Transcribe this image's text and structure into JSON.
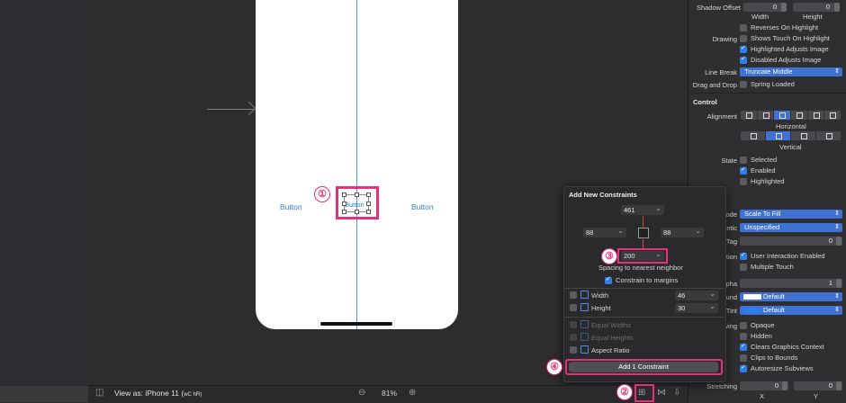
{
  "canvas": {
    "buttons": [
      "Button",
      "Button",
      "Button"
    ],
    "zoom": "81%",
    "view_as": "View as: iPhone 11 (",
    "view_as_trait": "wC hR)"
  },
  "badges": [
    "①",
    "②",
    "③",
    "④"
  ],
  "popover": {
    "title": "Add New Constraints",
    "top": "461",
    "left": "88",
    "right": "88",
    "bottom": "200",
    "spacing_label": "Spacing to nearest neighbor",
    "constrain_margins": "Constrain to margins",
    "rows": [
      {
        "label": "Width",
        "value": "46"
      },
      {
        "label": "Height",
        "value": "30"
      },
      {
        "label": "Equal Widths"
      },
      {
        "label": "Equal Heights"
      },
      {
        "label": "Aspect Ratio"
      }
    ],
    "add_button": "Add 1 Constraint"
  },
  "inspector": {
    "shadow_offset": {
      "label": "Shadow Offset",
      "x": "0",
      "y": "0",
      "w_label": "Width",
      "h_label": "Height"
    },
    "reverses": "Reverses On Highlight",
    "drawing": "Drawing",
    "shows_touch": "Shows Touch On Highlight",
    "highlighted_adjusts": "Highlighted Adjusts Image",
    "disabled_adjusts": "Disabled Adjusts Image",
    "line_break_label": "Line Break",
    "line_break_value": "Truncate Middle",
    "drag_drop_label": "Drag and Drop",
    "spring_loaded": "Spring Loaded",
    "control_title": "Control",
    "alignment_label": "Alignment",
    "horizontal": "Horizontal",
    "vertical": "Vertical",
    "state_label": "State",
    "selected": "Selected",
    "enabled": "Enabled",
    "highlighted": "Highlighted",
    "mode_label": "Mode",
    "mode_value": "Scale To Fill",
    "semantic_label": "Semantic",
    "semantic_value": "Unspecified",
    "tag_label": "Tag",
    "tag_value": "0",
    "interaction_label": "Interaction",
    "user_interaction": "User Interaction Enabled",
    "multiple_touch": "Multiple Touch",
    "alpha_label": "Alpha",
    "alpha_value": "1",
    "background_label": "Background",
    "background_value": "Default",
    "tint_label": "Tint",
    "tint_value": "Default",
    "drawing2_label": "Drawing",
    "opaque": "Opaque",
    "hidden": "Hidden",
    "clears": "Clears Graphics Context",
    "clips": "Clips to Bounds",
    "autoresize": "Autoresize Subviews",
    "stretching_label": "Stretching",
    "stretch_x": "0",
    "stretch_y": "0",
    "x_label": "X",
    "y_label": "Y"
  },
  "colors": {
    "highlight": "#e5307a",
    "accent": "#3f72d2",
    "link": "#2f84d4"
  }
}
